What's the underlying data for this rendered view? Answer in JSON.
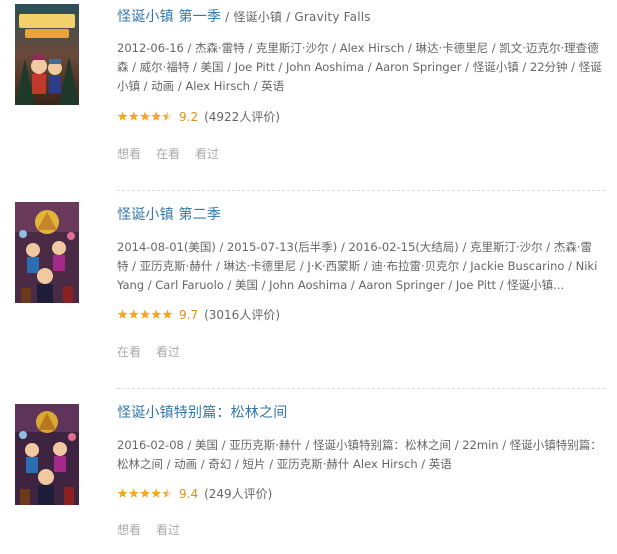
{
  "items": [
    {
      "title": "怪诞小镇 第一季",
      "subtitle": " / 怪诞小镇 / Gravity Falls",
      "meta": "2012-06-16 / 杰森·雷特 / 克里斯汀·沙尔 / Alex Hirsch / 琳达·卡德里尼 / 凯文·迈克尔·理查德森 / 威尔·福特 / 美国 / Joe Pitt / John Aoshima / Aaron Springer / 怪诞小镇 / 22分钟 / 怪诞小镇 / 动画 / Alex Hirsch / 英语",
      "score": "9.2",
      "stars": 4.5,
      "count": "(4922人评价)",
      "actions": [
        "想看",
        "在看",
        "看过"
      ]
    },
    {
      "title": "怪诞小镇 第二季",
      "subtitle": "",
      "meta": "2014-08-01(美国) / 2015-07-13(后半季) / 2016-02-15(大结局) / 克里斯汀·沙尔 / 杰森·雷特 / 亚历克斯·赫什 / 琳达·卡德里尼 / J·K·西蒙斯 / 迪·布拉雷·贝克尔 / Jackie Buscarino / Niki Yang / Carl Faruolo / 美国 / John Aoshima / Aaron Springer / Joe Pitt / 怪诞小镇...",
      "score": "9.7",
      "stars": 5,
      "count": "(3016人评价)",
      "actions": [
        "在看",
        "看过"
      ]
    },
    {
      "title": "怪诞小镇特别篇：松林之间",
      "subtitle": "",
      "meta": "2016-02-08 / 美国 / 亚历克斯·赫什 / 怪诞小镇特别篇：松林之间 / 22min / 怪诞小镇特别篇：松林之间 / 动画 / 奇幻 / 短片 / 亚历克斯·赫什 Alex Hirsch / 英语",
      "score": "9.4",
      "stars": 4.5,
      "count": "(249人评价)",
      "actions": [
        "想看",
        "看过"
      ]
    }
  ],
  "colors": {
    "title": "#3377aa",
    "text": "#666666",
    "score": "#e09015",
    "star": "#f5a623",
    "action": "#aaaaaa",
    "divider": "#dddddd"
  },
  "icons": {
    "poster": "gravity-falls-poster-icon",
    "star": "star-icon"
  }
}
